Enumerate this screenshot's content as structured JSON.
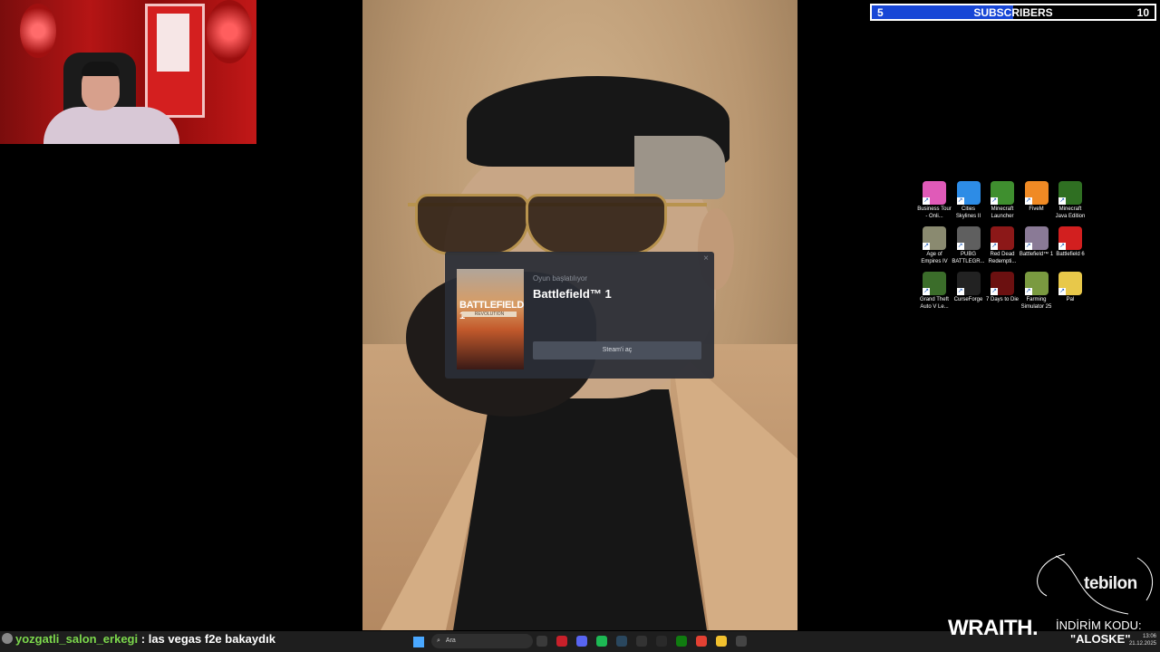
{
  "subscribers": {
    "current": "5",
    "label": "SUBSCRIBERS",
    "goal": "10",
    "progress_fraction": 0.5,
    "fill_color": "#1746d6"
  },
  "desktop_icons": [
    {
      "label": "Business Tour - Onli...",
      "icon": "business-tour-icon",
      "color": "#e05ab8"
    },
    {
      "label": "Cities Skylines II",
      "icon": "cities-skylines-icon",
      "color": "#2d8ce6"
    },
    {
      "label": "Minecraft Launcher",
      "icon": "minecraft-launcher-icon",
      "color": "#3f8f2f"
    },
    {
      "label": "FiveM",
      "icon": "fivem-icon",
      "color": "#f08a24"
    },
    {
      "label": "Minecraft Java Edition",
      "icon": "minecraft-java-icon",
      "color": "#2f6f22"
    },
    {
      "label": "Age of Empires IV",
      "icon": "age-of-empires-icon",
      "color": "#8a8a70"
    },
    {
      "label": "PUBG BATTLEGR...",
      "icon": "pubg-icon",
      "color": "#5f5f5f"
    },
    {
      "label": "Red Dead Redempti...",
      "icon": "red-dead-icon",
      "color": "#8c1818"
    },
    {
      "label": "Battlefield™ 1",
      "icon": "battlefield-1-icon",
      "color": "#8a7a96"
    },
    {
      "label": "Battlefield 6",
      "icon": "battlefield-6-icon",
      "color": "#d21f1f"
    },
    {
      "label": "Grand Theft Auto V Le...",
      "icon": "gta-v-icon",
      "color": "#3b6d2a"
    },
    {
      "label": "CurseForge",
      "icon": "curseforge-icon",
      "color": "#222222"
    },
    {
      "label": "7 Days to Die",
      "icon": "seven-days-icon",
      "color": "#6b1010"
    },
    {
      "label": "Farming Simulator 25",
      "icon": "farming-sim-icon",
      "color": "#7a9a40"
    },
    {
      "label": "Pal",
      "icon": "pal-icon",
      "color": "#e8c84a"
    }
  ],
  "popup": {
    "subtitle": "Oyun başlatılıyor",
    "title": "Battlefield™ 1",
    "button": "Steam'i aç",
    "cover_title": "BATTLEFIELD 1",
    "cover_sub": "REVOLUTION",
    "close": "×"
  },
  "chat": {
    "username": "yozgatli_salon_erkegi",
    "separator": ":",
    "message": "las vegas f2e bakaydık"
  },
  "taskbar": {
    "search_placeholder": "Ara",
    "time": "13:06",
    "date": "21.12.2025",
    "apps": [
      "start-icon",
      "search-icon",
      "widgets-icon",
      "file-icon",
      "opera-icon",
      "discord-icon",
      "spotify-icon",
      "steam-icon",
      "epic-icon",
      "cs-icon",
      "xbox-icon",
      "chrome-icon",
      "explorer-icon",
      "settings-icon"
    ]
  },
  "sponsor": {
    "brand": "tebilon",
    "wraith": "WRAITH.",
    "promo_label": "İNDİRİM KODU:",
    "promo_code": "\"ALOSKE\""
  }
}
